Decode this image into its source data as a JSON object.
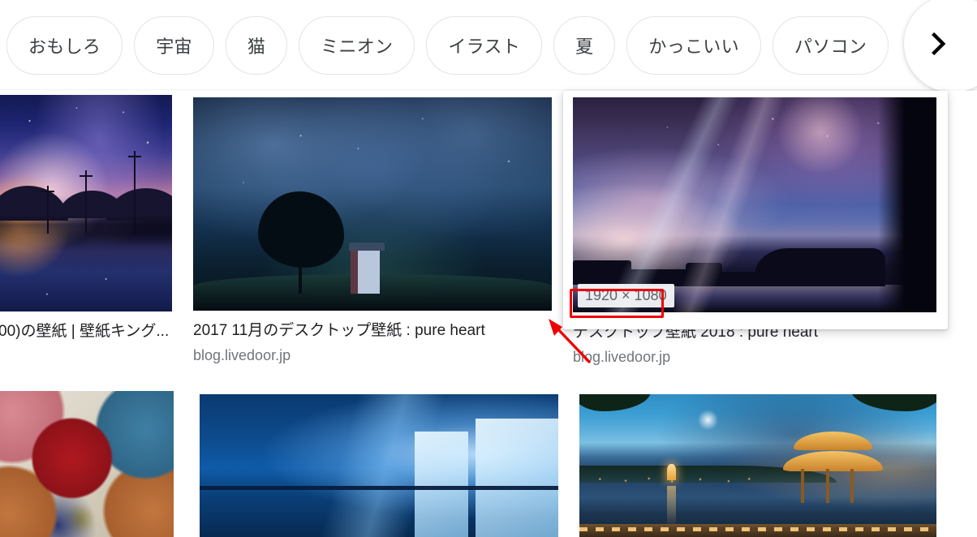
{
  "chip_bar": {
    "chips": [
      {
        "label": "おもしろ"
      },
      {
        "label": "宇宙"
      },
      {
        "label": "猫"
      },
      {
        "label": "ミニオン"
      },
      {
        "label": "イラスト"
      },
      {
        "label": "夏"
      },
      {
        "label": "かっこいい"
      },
      {
        "label": "パソコン"
      }
    ],
    "next_icon": "chevron-right-icon"
  },
  "results": {
    "row1": [
      {
        "title": "00)の壁紙 | 壁紙キング...",
        "source": "",
        "size_badge": "",
        "art": "anime-sunset-powerlines"
      },
      {
        "title": "2017 11月のデスクトップ壁紙 : pure heart",
        "source": "blog.livedoor.jp",
        "size_badge": "",
        "art": "night-sky-tree-door"
      },
      {
        "title": "デスクトップ壁紙 2018 : pure heart",
        "source": "blog.livedoor.jp",
        "size_badge": "1920 × 1080",
        "art": "starry-mesa-lake",
        "hovered": true
      }
    ],
    "row2": [
      {
        "title": "",
        "source": "",
        "art": "colorful-umbrellas"
      },
      {
        "title": "",
        "source": "",
        "art": "windows-10-hero"
      },
      {
        "title": "",
        "source": "",
        "art": "west-lake-pavilion"
      }
    ]
  },
  "annotations": {
    "highlight_color": "#ee0000",
    "rect_target": "size-badge",
    "arrow_direction": "up-left"
  }
}
